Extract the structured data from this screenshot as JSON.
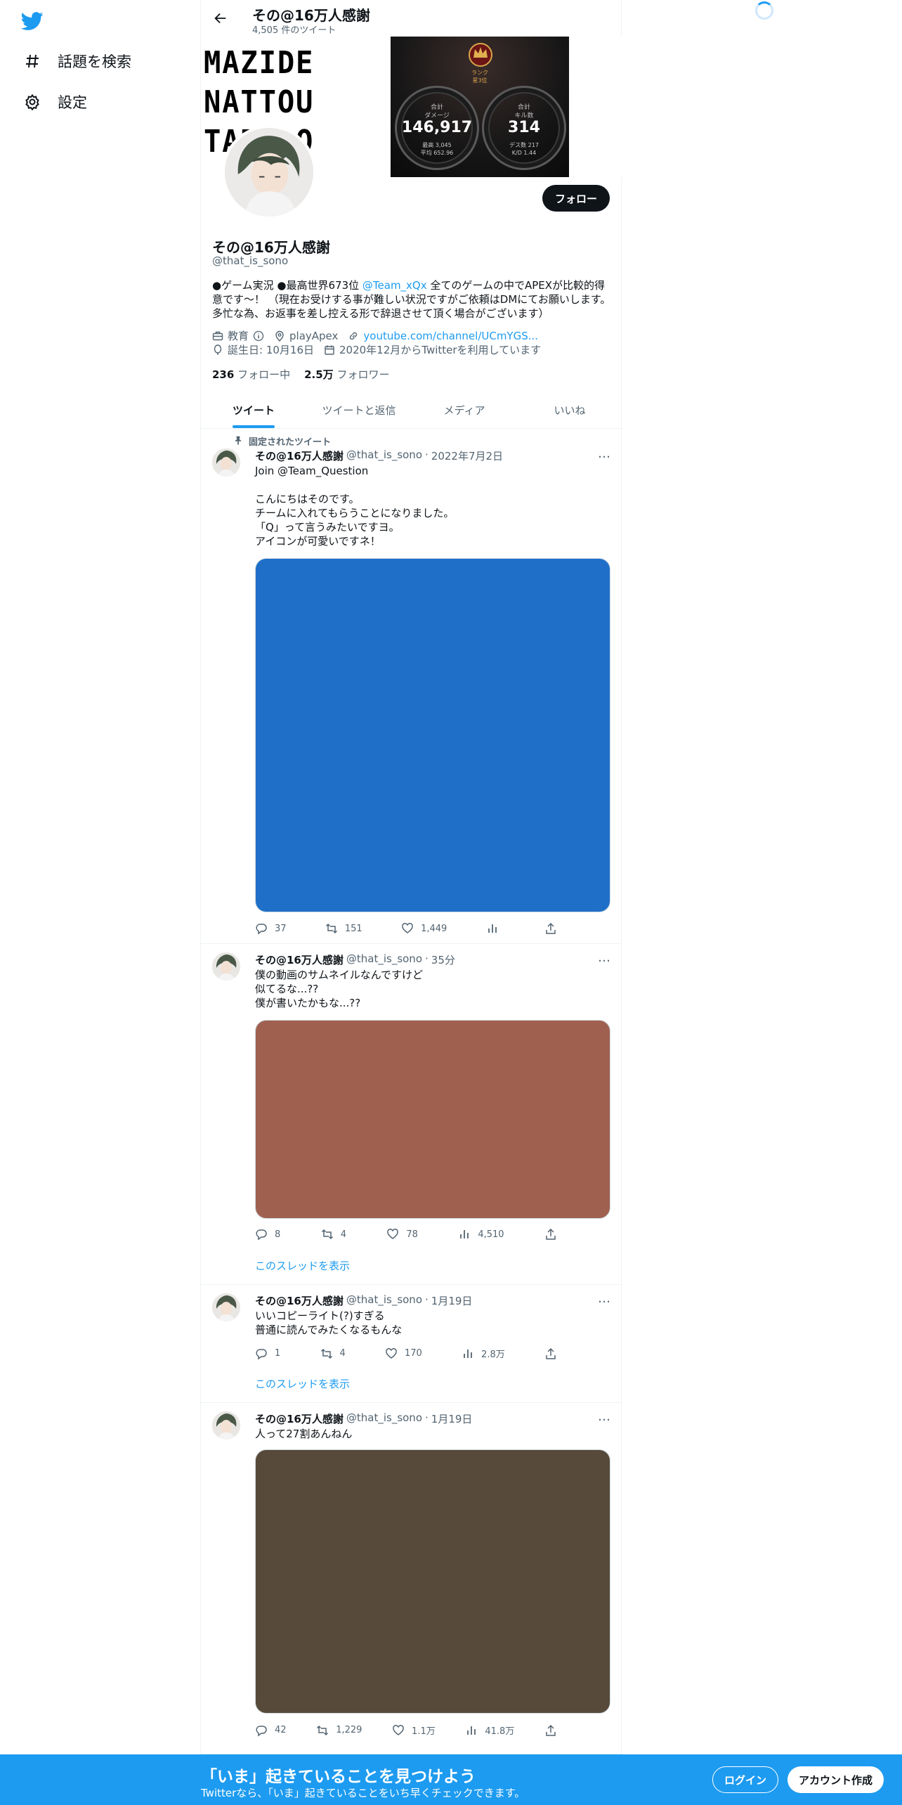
{
  "nav": {
    "items": [
      {
        "label": "話題を検索",
        "icon": "hashtag-icon"
      },
      {
        "label": "設定",
        "icon": "gear-icon"
      }
    ]
  },
  "header": {
    "title": "その@16万人感謝",
    "tweet_count": "4,505 件のツイート"
  },
  "banner": {
    "text_lines": [
      "MAZIDE",
      "NATTOU",
      "TABERO"
    ],
    "rank_label": "ランク",
    "rank_sub": "星3位",
    "stat1_caption": "合計\nダメージ",
    "stat1_value": "146,917",
    "stat1_sub": "最高 3,045\n平均 652.96",
    "stat2_caption": "合計\nキル数",
    "stat2_value": "314",
    "stat2_sub": "デス数 217\nK/D 1.44"
  },
  "profile": {
    "follow_label": "フォロー",
    "name": "その@16万人感謝",
    "handle": "@that_is_sono",
    "bio_before": "●ゲーム実況 ●最高世界673位 ",
    "bio_link": "@Team_xQx",
    "bio_after": " 全てのゲームの中でAPEXが比較的得意です～！ （現在お受けする事が難しい状況ですがご依頼はDMにてお願いします。多忙な為、お返事を差し控える形で辞退させて頂く場合がございます）",
    "category": "教育",
    "location": "playApex",
    "url": "youtube.com/channel/UCmYGS...",
    "birthday": "誕生日: 10月16日",
    "joined": "2020年12月からTwitterを利用しています",
    "following_count": "236",
    "following_label": "フォロー中",
    "followers_count": "2.5万",
    "followers_label": "フォロワー"
  },
  "tabs": [
    "ツイート",
    "ツイートと返信",
    "メディア",
    "いいね"
  ],
  "pinned_label": "固定されたツイート",
  "thread_label": "このスレッドを表示",
  "tweets": [
    {
      "name": "その@16万人感謝",
      "handle": "@that_is_sono",
      "time": "2022年7月2日",
      "text": "Join @Team_Question\n\nこんにちはそのです。\nチームに入れてもらうことになりました。\n「Q」って言うみたいですヨ。\nアイコンが可愛いですネ！",
      "media_color": "#1f6fc9",
      "replies": "37",
      "retweets": "151",
      "likes": "1,449",
      "views": ""
    },
    {
      "name": "その@16万人感謝",
      "handle": "@that_is_sono",
      "time": "35分",
      "text": "僕の動画のサムネイルなんですけど\n似てるな...??\n僕が書いたかもな...??",
      "media_color": "#a06050",
      "replies": "8",
      "retweets": "4",
      "likes": "78",
      "views": "4,510"
    },
    {
      "name": "その@16万人感謝",
      "handle": "@that_is_sono",
      "time": "1月19日",
      "text": "いいコピーライト(?)すぎる\n普通に読んでみたくなるもんな",
      "replies": "1",
      "retweets": "4",
      "likes": "170",
      "views": "2.8万"
    },
    {
      "name": "その@16万人感謝",
      "handle": "@that_is_sono",
      "time": "1月19日",
      "text": "人って27割あんねん",
      "media_color": "#574a3a",
      "replies": "42",
      "retweets": "1,229",
      "likes": "1.1万",
      "views": "41.8万"
    }
  ],
  "bottom_bar": {
    "title": "「いま」起きていることを見つけよう",
    "subtitle": "Twitterなら、「いま」起きていることをいち早くチェックできます。",
    "login": "ログイン",
    "signup": "アカウント作成"
  },
  "colors": {
    "accent": "#1d9bf0",
    "text": "#0f1419",
    "secondary": "#536471"
  }
}
